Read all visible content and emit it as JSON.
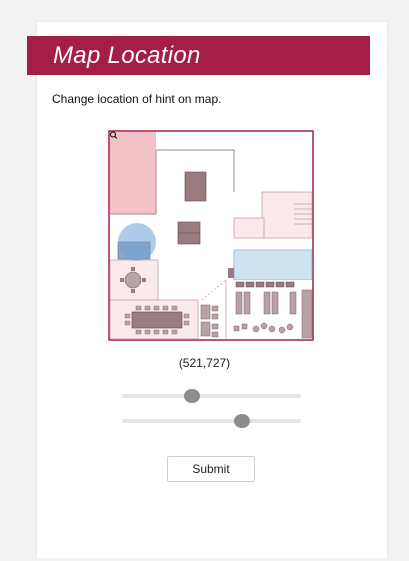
{
  "header": {
    "title": "Map Location"
  },
  "instruction": "Change location of hint on map.",
  "map": {
    "zoom_icon": "magnifier-icon",
    "accent_color": "#a41e47",
    "hint_marker_color": "#6fa0d8"
  },
  "coordinates_text": "(521,727)",
  "sliders": [
    {
      "name": "x",
      "value_fraction": 0.39
    },
    {
      "name": "y",
      "value_fraction": 0.67
    }
  ],
  "submit": {
    "label": "Submit"
  },
  "colors": {
    "title_bar": "#a41e47",
    "background": "#f2f2f2",
    "slider_thumb": "#8c8c8c"
  }
}
